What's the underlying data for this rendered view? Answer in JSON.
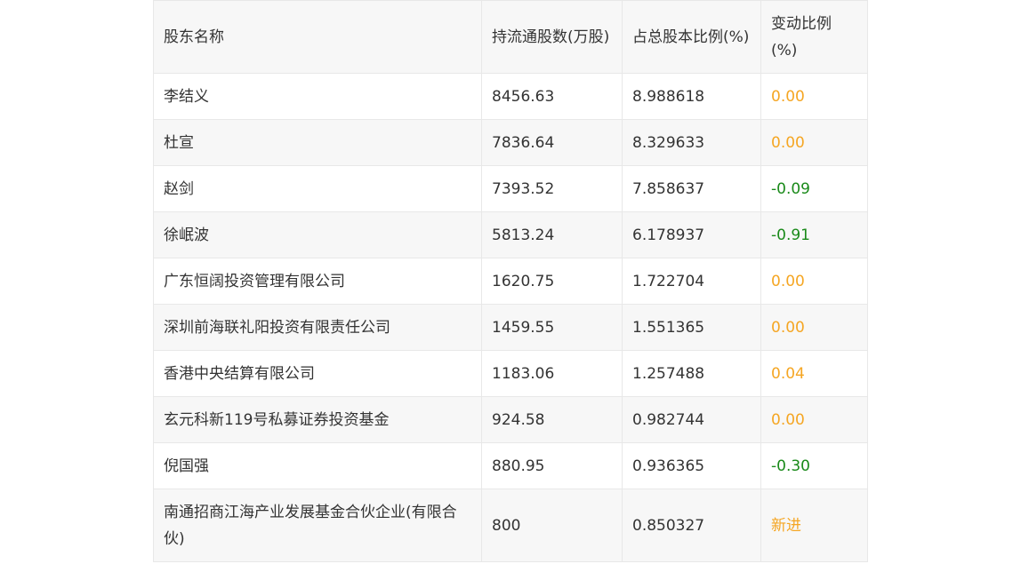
{
  "table": {
    "headers": [
      "股东名称",
      "持流通股数(万股)",
      "占总股本比例(%)",
      "变动比例(%)"
    ],
    "rows": [
      {
        "name": "李结义",
        "shares": "8456.63",
        "ratio": "8.988618",
        "change": "0.00",
        "change_color": "#f5a623"
      },
      {
        "name": "杜宣",
        "shares": "7836.64",
        "ratio": "8.329633",
        "change": "0.00",
        "change_color": "#f5a623"
      },
      {
        "name": "赵剑",
        "shares": "7393.52",
        "ratio": "7.858637",
        "change": "-0.09",
        "change_color": "#1a8a1a"
      },
      {
        "name": "徐岷波",
        "shares": "5813.24",
        "ratio": "6.178937",
        "change": "-0.91",
        "change_color": "#1a8a1a"
      },
      {
        "name": "广东恒阔投资管理有限公司",
        "shares": "1620.75",
        "ratio": "1.722704",
        "change": "0.00",
        "change_color": "#f5a623"
      },
      {
        "name": "深圳前海联礼阳投资有限责任公司",
        "shares": "1459.55",
        "ratio": "1.551365",
        "change": "0.00",
        "change_color": "#f5a623"
      },
      {
        "name": "香港中央结算有限公司",
        "shares": "1183.06",
        "ratio": "1.257488",
        "change": "0.04",
        "change_color": "#f5a623"
      },
      {
        "name": "玄元科新119号私募证券投资基金",
        "shares": "924.58",
        "ratio": "0.982744",
        "change": "0.00",
        "change_color": "#f5a623"
      },
      {
        "name": "倪国强",
        "shares": "880.95",
        "ratio": "0.936365",
        "change": "-0.30",
        "change_color": "#1a8a1a"
      },
      {
        "name": "南通招商江海产业发展基金合伙企业(有限合伙)",
        "shares": "800",
        "ratio": "0.850327",
        "change": "新进",
        "change_color": "#f5a623"
      }
    ]
  }
}
